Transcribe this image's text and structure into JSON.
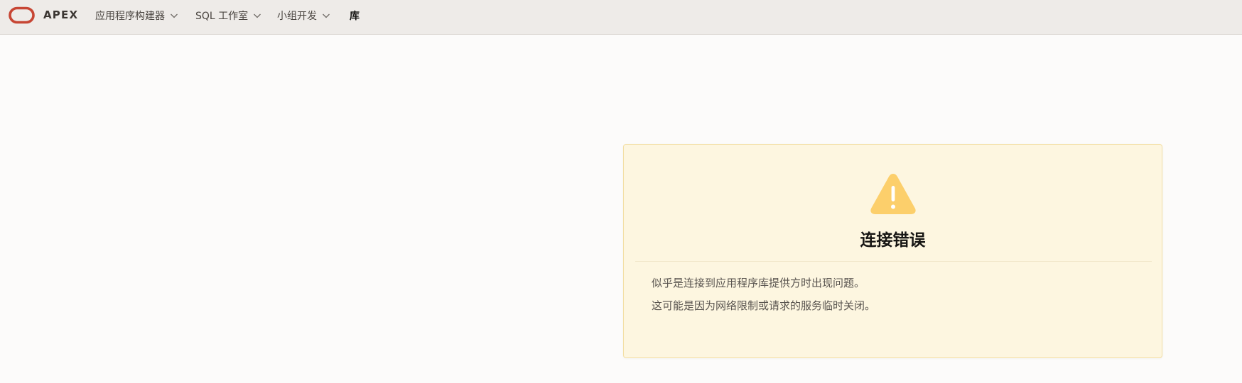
{
  "header": {
    "brand": "APEX",
    "nav": [
      {
        "label": "应用程序构建器",
        "has_menu": true
      },
      {
        "label": "SQL 工作室",
        "has_menu": true
      },
      {
        "label": "小组开发",
        "has_menu": true
      },
      {
        "label": "库",
        "has_menu": false,
        "active": true
      }
    ]
  },
  "alert": {
    "icon": "warning-icon",
    "title": "连接错误",
    "messages": [
      "似乎是连接到应用程序库提供方时出现问题。",
      "这可能是因为网络限制或请求的服务临时关闭。"
    ]
  },
  "colors": {
    "logo": "#c74634",
    "warning": "#fccf6b",
    "card_bg": "#fdf6e0",
    "header_bg": "#eeebe8"
  }
}
